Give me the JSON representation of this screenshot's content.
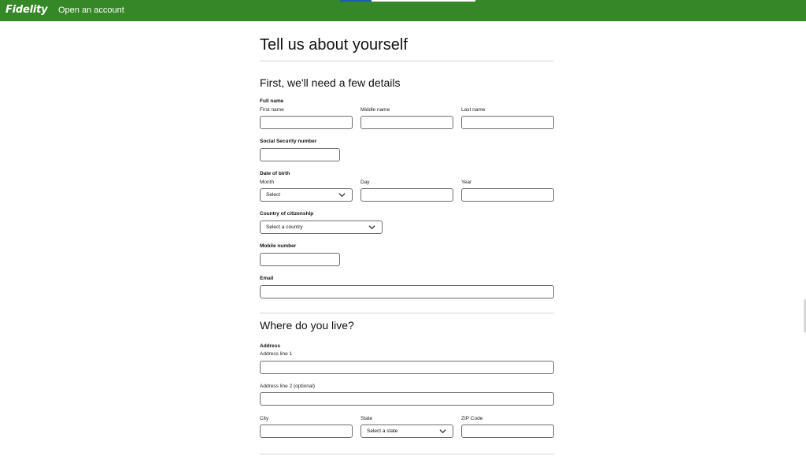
{
  "header": {
    "brand": "Fidelity",
    "title": "Open an account",
    "progress_fraction": 0.23,
    "colors": {
      "bar": "#368727",
      "progress": "#1b5fa8"
    }
  },
  "page": {
    "title": "Tell us about yourself"
  },
  "details_section": {
    "title": "First, we'll need a few details",
    "full_name": {
      "label": "Full name",
      "first_label": "First name",
      "middle_label": "Middle name",
      "last_label": "Last name"
    },
    "ssn": {
      "label": "Social Security number"
    },
    "dob": {
      "label": "Date of birth",
      "month_label": "Month",
      "month_value": "Select",
      "day_label": "Day",
      "year_label": "Year"
    },
    "citizenship": {
      "label": "Country of citizenship",
      "value": "Select a country"
    },
    "mobile": {
      "label": "Mobile number"
    },
    "email": {
      "label": "Email"
    }
  },
  "address_section": {
    "title": "Where do you live?",
    "address": {
      "label": "Address",
      "line1_label": "Address line 1",
      "line2_label": "Address line 2 (optional)"
    },
    "city_label": "City",
    "state_label": "State",
    "state_value": "Select a state",
    "zip_label": "ZIP Code"
  },
  "icons": {
    "dropdown": "chevron-down-icon"
  }
}
